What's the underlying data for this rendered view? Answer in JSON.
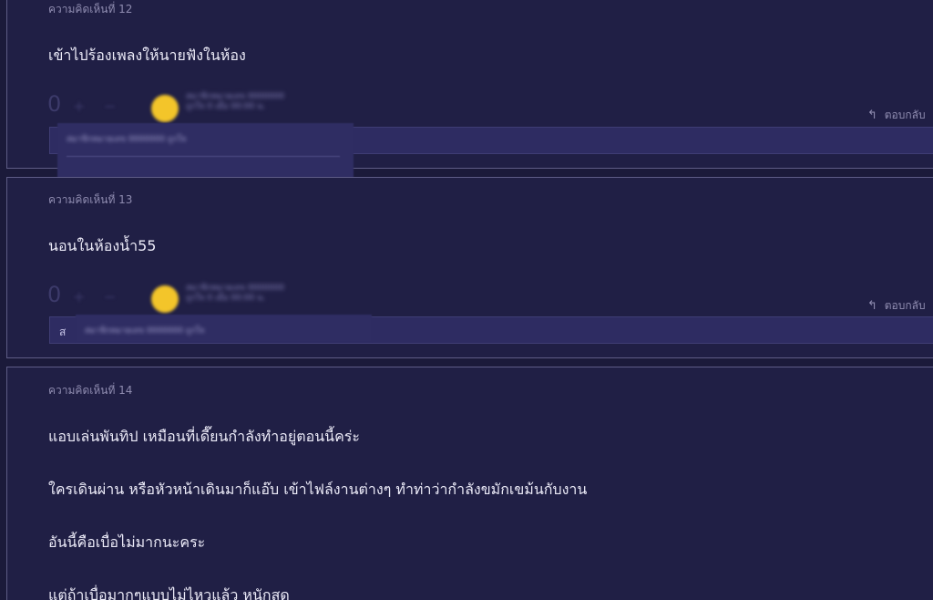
{
  "comments": [
    {
      "number": "ความคิดเห็นที่ 12",
      "text": "เข้าไปร้องเพลงให้นายฟังในห้อง",
      "votes": "0",
      "vote_plus": "+",
      "vote_minus": "−",
      "username": "สมาชิกหมายเลข 0000000",
      "user_time": "ถูกใจ 0 เมื่อ 00:00 น.",
      "reply": "ตอบกลับ",
      "blur_text": "สมาชิกหมายเลข 0000000 ถูกใจ"
    },
    {
      "number": "ความคิดเห็นที่ 13",
      "text": "นอนในห้องน้ำ55",
      "votes": "0",
      "vote_plus": "+",
      "vote_minus": "−",
      "username": "สมาชิกหมายเลข 0000000",
      "user_time": "ถูกใจ 0 เมื่อ 00:00 น.",
      "reply": "ตอบกลับ",
      "blur_text": "สมาชิกหมายเลข 0000000 ถูกใจ",
      "share_prefix": "ส"
    },
    {
      "number": "ความคิดเห็นที่ 14",
      "lines": [
        "แอบเล่นพันทิป เหมือนที่เดี๊ยนกำลังทำอยู่ตอนนี้คร่ะ",
        "ใครเดินผ่าน หรือหัวหน้าเดินมาก็แอ๊บ เข้าไฟล์งานต่างๆ ทำท่าว่ากำลังขมักเขม้นกับงาน",
        "อันนี้คือเบื่อไม่มากนะคระ",
        "แต่ถ้าเบื่อมากๆแบบไม่ไหวแล้ว หนักสุด"
      ]
    }
  ],
  "icons": {
    "reply": "reply-icon",
    "vote_plus": "plus-icon",
    "vote_minus": "minus-icon",
    "avatar": "user-avatar"
  },
  "colors": {
    "background": "#1b1a3a",
    "card": "#201f45",
    "accent": "#f3c52a",
    "share_box": "#2e2c62"
  }
}
